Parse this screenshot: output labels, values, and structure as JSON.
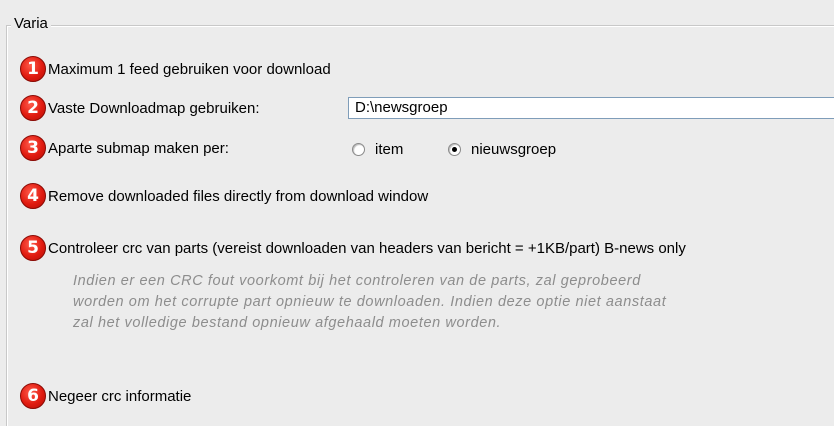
{
  "group": {
    "title": "Varia"
  },
  "options": [
    {
      "number": "1",
      "label": "Maximum 1 feed gebruiken voor download"
    },
    {
      "number": "2",
      "label": "Vaste Downloadmap gebruiken:",
      "input_value": "D:\\newsgroep"
    },
    {
      "number": "3",
      "label": "Aparte submap maken per:",
      "radio": {
        "item": "item",
        "nieuwsgroep": "nieuwsgroep",
        "selected": "nieuwsgroep"
      }
    },
    {
      "number": "4",
      "label": "Remove downloaded files directly from download window"
    },
    {
      "number": "5",
      "label": "Controleer crc van parts (vereist downloaden van headers van bericht = +1KB/part) B-news only"
    },
    {
      "number": "6",
      "label": "Negeer crc informatie"
    }
  ],
  "crc_note": [
    "Indien er een CRC fout voorkomt bij het controleren van de parts, zal geprobeerd",
    "worden om het corrupte part opnieuw te downloaden. Indien deze optie niet aanstaat",
    "zal het volledige bestand opnieuw afgehaald moeten worden."
  ],
  "colors": {
    "badge": "#e01b10",
    "note_text": "#8d8d8d",
    "background": "#ececec"
  }
}
